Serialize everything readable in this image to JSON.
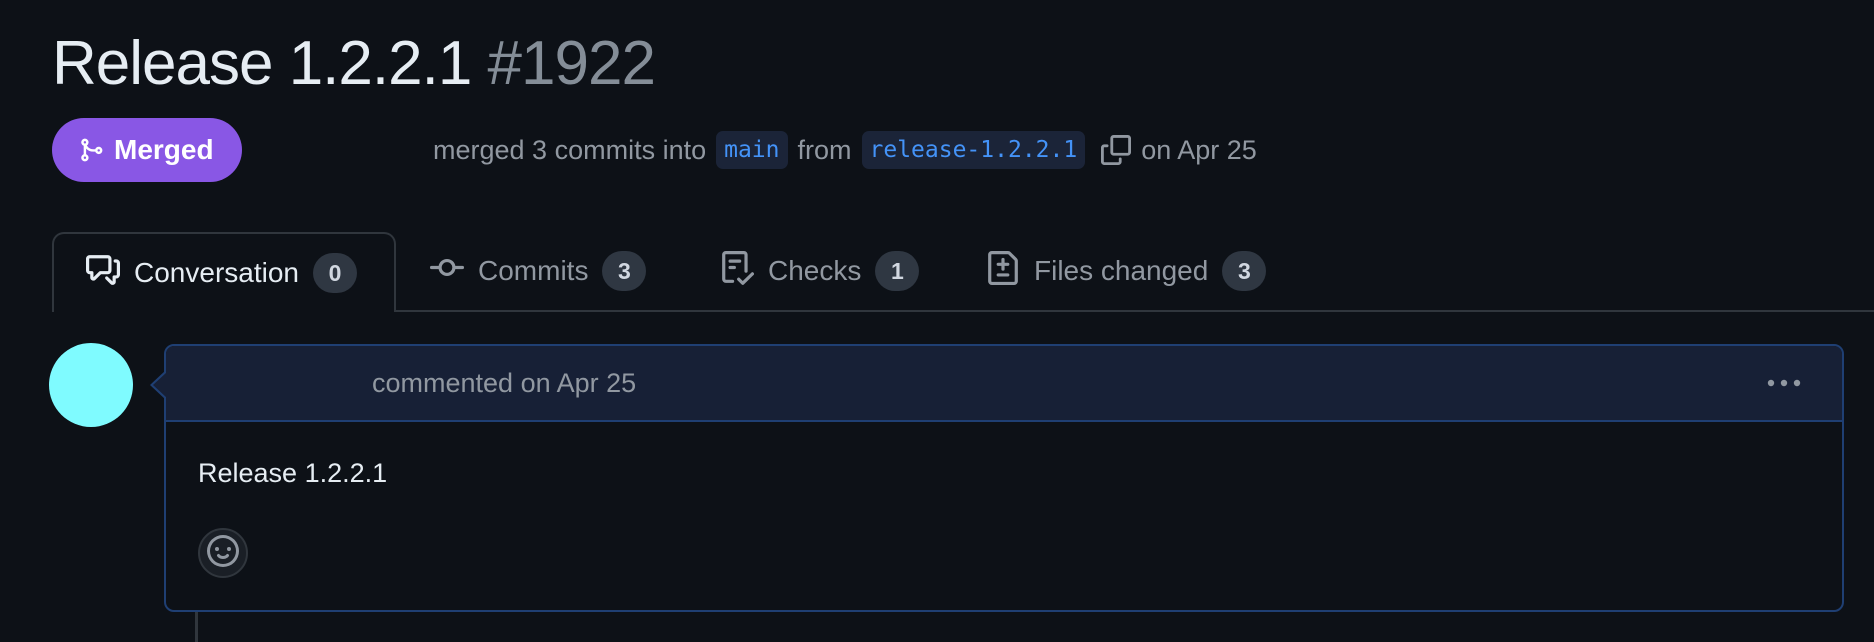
{
  "pull_request": {
    "title": "Release 1.2.2.1",
    "number": "#1922",
    "state": "Merged",
    "meta": {
      "merged_text": "merged 3 commits into",
      "base_branch": "main",
      "from_text": "from",
      "head_branch": "release-1.2.2.1",
      "date_text": "on Apr 25"
    }
  },
  "tabs": [
    {
      "label": "Conversation",
      "count": "0",
      "icon": "comment-discussion-icon",
      "active": true
    },
    {
      "label": "Commits",
      "count": "3",
      "icon": "git-commit-icon",
      "active": false
    },
    {
      "label": "Checks",
      "count": "1",
      "icon": "checklist-icon",
      "active": false
    },
    {
      "label": "Files changed",
      "count": "3",
      "icon": "file-diff-icon",
      "active": false
    }
  ],
  "comment": {
    "meta": "commented on Apr 25",
    "body": "Release 1.2.2.1",
    "avatar_color": "#7ffbff"
  },
  "colors": {
    "background": "#0d1117",
    "merged": "#8957e5",
    "branch_text": "#4493f8",
    "comment_border": "#1f3f73",
    "comment_header": "#172036"
  }
}
